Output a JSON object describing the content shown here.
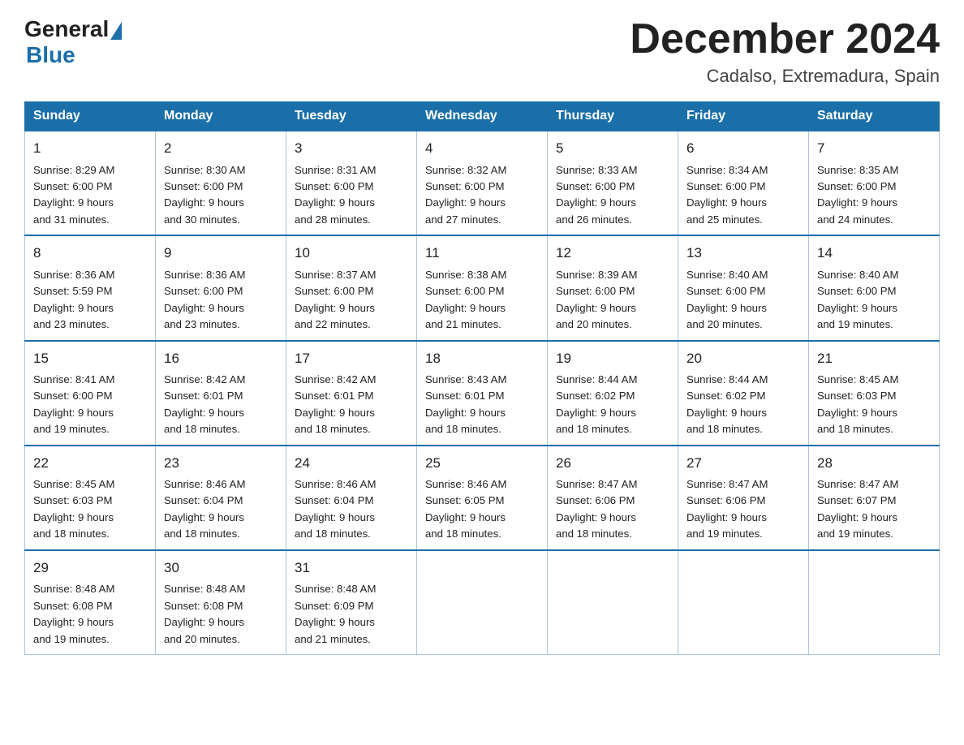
{
  "logo": {
    "general": "General",
    "blue": "Blue"
  },
  "header": {
    "month": "December 2024",
    "location": "Cadalso, Extremadura, Spain"
  },
  "weekdays": [
    "Sunday",
    "Monday",
    "Tuesday",
    "Wednesday",
    "Thursday",
    "Friday",
    "Saturday"
  ],
  "weeks": [
    [
      {
        "day": "1",
        "info": "Sunrise: 8:29 AM\nSunset: 6:00 PM\nDaylight: 9 hours\nand 31 minutes."
      },
      {
        "day": "2",
        "info": "Sunrise: 8:30 AM\nSunset: 6:00 PM\nDaylight: 9 hours\nand 30 minutes."
      },
      {
        "day": "3",
        "info": "Sunrise: 8:31 AM\nSunset: 6:00 PM\nDaylight: 9 hours\nand 28 minutes."
      },
      {
        "day": "4",
        "info": "Sunrise: 8:32 AM\nSunset: 6:00 PM\nDaylight: 9 hours\nand 27 minutes."
      },
      {
        "day": "5",
        "info": "Sunrise: 8:33 AM\nSunset: 6:00 PM\nDaylight: 9 hours\nand 26 minutes."
      },
      {
        "day": "6",
        "info": "Sunrise: 8:34 AM\nSunset: 6:00 PM\nDaylight: 9 hours\nand 25 minutes."
      },
      {
        "day": "7",
        "info": "Sunrise: 8:35 AM\nSunset: 6:00 PM\nDaylight: 9 hours\nand 24 minutes."
      }
    ],
    [
      {
        "day": "8",
        "info": "Sunrise: 8:36 AM\nSunset: 5:59 PM\nDaylight: 9 hours\nand 23 minutes."
      },
      {
        "day": "9",
        "info": "Sunrise: 8:36 AM\nSunset: 6:00 PM\nDaylight: 9 hours\nand 23 minutes."
      },
      {
        "day": "10",
        "info": "Sunrise: 8:37 AM\nSunset: 6:00 PM\nDaylight: 9 hours\nand 22 minutes."
      },
      {
        "day": "11",
        "info": "Sunrise: 8:38 AM\nSunset: 6:00 PM\nDaylight: 9 hours\nand 21 minutes."
      },
      {
        "day": "12",
        "info": "Sunrise: 8:39 AM\nSunset: 6:00 PM\nDaylight: 9 hours\nand 20 minutes."
      },
      {
        "day": "13",
        "info": "Sunrise: 8:40 AM\nSunset: 6:00 PM\nDaylight: 9 hours\nand 20 minutes."
      },
      {
        "day": "14",
        "info": "Sunrise: 8:40 AM\nSunset: 6:00 PM\nDaylight: 9 hours\nand 19 minutes."
      }
    ],
    [
      {
        "day": "15",
        "info": "Sunrise: 8:41 AM\nSunset: 6:00 PM\nDaylight: 9 hours\nand 19 minutes."
      },
      {
        "day": "16",
        "info": "Sunrise: 8:42 AM\nSunset: 6:01 PM\nDaylight: 9 hours\nand 18 minutes."
      },
      {
        "day": "17",
        "info": "Sunrise: 8:42 AM\nSunset: 6:01 PM\nDaylight: 9 hours\nand 18 minutes."
      },
      {
        "day": "18",
        "info": "Sunrise: 8:43 AM\nSunset: 6:01 PM\nDaylight: 9 hours\nand 18 minutes."
      },
      {
        "day": "19",
        "info": "Sunrise: 8:44 AM\nSunset: 6:02 PM\nDaylight: 9 hours\nand 18 minutes."
      },
      {
        "day": "20",
        "info": "Sunrise: 8:44 AM\nSunset: 6:02 PM\nDaylight: 9 hours\nand 18 minutes."
      },
      {
        "day": "21",
        "info": "Sunrise: 8:45 AM\nSunset: 6:03 PM\nDaylight: 9 hours\nand 18 minutes."
      }
    ],
    [
      {
        "day": "22",
        "info": "Sunrise: 8:45 AM\nSunset: 6:03 PM\nDaylight: 9 hours\nand 18 minutes."
      },
      {
        "day": "23",
        "info": "Sunrise: 8:46 AM\nSunset: 6:04 PM\nDaylight: 9 hours\nand 18 minutes."
      },
      {
        "day": "24",
        "info": "Sunrise: 8:46 AM\nSunset: 6:04 PM\nDaylight: 9 hours\nand 18 minutes."
      },
      {
        "day": "25",
        "info": "Sunrise: 8:46 AM\nSunset: 6:05 PM\nDaylight: 9 hours\nand 18 minutes."
      },
      {
        "day": "26",
        "info": "Sunrise: 8:47 AM\nSunset: 6:06 PM\nDaylight: 9 hours\nand 18 minutes."
      },
      {
        "day": "27",
        "info": "Sunrise: 8:47 AM\nSunset: 6:06 PM\nDaylight: 9 hours\nand 19 minutes."
      },
      {
        "day": "28",
        "info": "Sunrise: 8:47 AM\nSunset: 6:07 PM\nDaylight: 9 hours\nand 19 minutes."
      }
    ],
    [
      {
        "day": "29",
        "info": "Sunrise: 8:48 AM\nSunset: 6:08 PM\nDaylight: 9 hours\nand 19 minutes."
      },
      {
        "day": "30",
        "info": "Sunrise: 8:48 AM\nSunset: 6:08 PM\nDaylight: 9 hours\nand 20 minutes."
      },
      {
        "day": "31",
        "info": "Sunrise: 8:48 AM\nSunset: 6:09 PM\nDaylight: 9 hours\nand 21 minutes."
      },
      null,
      null,
      null,
      null
    ]
  ]
}
